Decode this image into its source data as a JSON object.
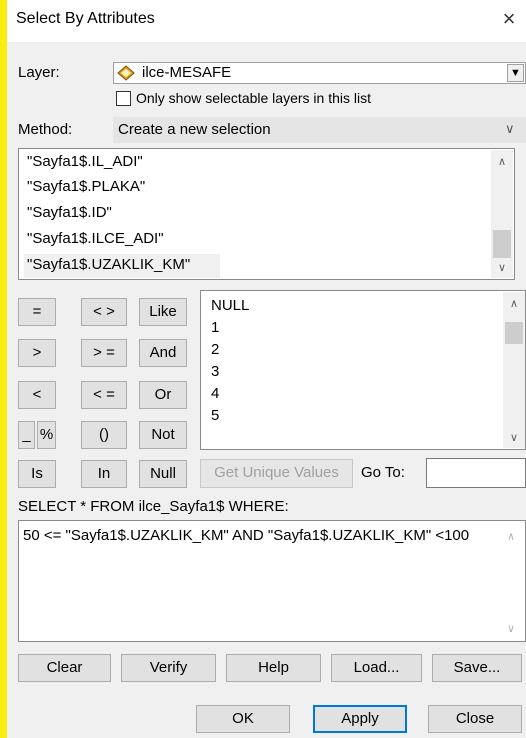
{
  "dialog": {
    "title": "Select By Attributes",
    "close_glyph": "×"
  },
  "layer": {
    "label": "Layer:",
    "value": "ilce-MESAFE",
    "only_selectable_label": "Only show selectable layers in this list",
    "only_selectable_checked": false
  },
  "method": {
    "label": "Method:",
    "value": "Create a new selection"
  },
  "fields": [
    "\"Sayfa1$.IL_ADI\"",
    "\"Sayfa1$.PLAKA\"",
    "\"Sayfa1$.ID\"",
    "\"Sayfa1$.ILCE_ADI\"",
    "\"Sayfa1$.UZAKLIK_KM\""
  ],
  "operators": {
    "equals": "=",
    "not_equal": "< >",
    "like": "Like",
    "greater": ">",
    "greater_equal": "> =",
    "and": "And",
    "less": "<",
    "less_equal": "< =",
    "or": "Or",
    "underscore": "_",
    "percent": "%",
    "parens": "()",
    "not": "Not",
    "is": "Is",
    "in": "In",
    "null": "Null"
  },
  "values": [
    "NULL",
    "1",
    "2",
    "3",
    "4",
    "5"
  ],
  "get_unique_values_label": "Get Unique Values",
  "goto_label": "Go To:",
  "goto_value": "",
  "query": {
    "header": "SELECT * FROM ilce_Sayfa1$ WHERE:",
    "expression": "50 <= \"Sayfa1$.UZAKLIK_KM\" AND \"Sayfa1$.UZAKLIK_KM\" <100"
  },
  "actions": {
    "clear": "Clear",
    "verify": "Verify",
    "help": "Help",
    "load": "Load...",
    "save": "Save..."
  },
  "footer": {
    "ok": "OK",
    "apply": "Apply",
    "close": "Close"
  },
  "colors": {
    "accent": "#0078d7",
    "side_bar": "#f7ee12",
    "layer_icon": "#e8a317"
  }
}
